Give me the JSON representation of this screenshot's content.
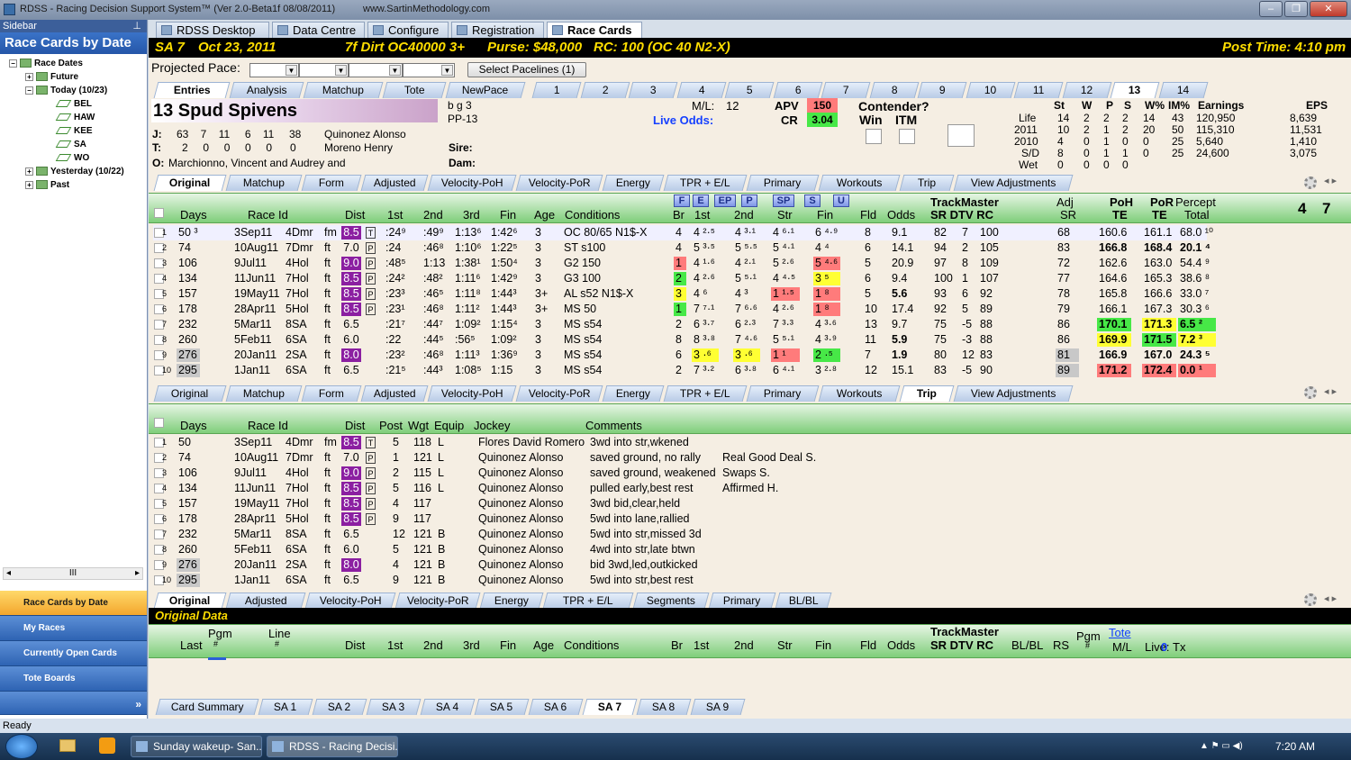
{
  "window": {
    "title": "RDSS - Racing Decision Support System™ (Ver 2.0-Beta1f  08/08/2011)",
    "site": "www.SartinMethodology.com"
  },
  "sidebar": {
    "header": "Sidebar",
    "title": "Race Cards by Date",
    "tree": [
      "Race Dates",
      "Future",
      "Today (10/23)",
      "BEL",
      "HAW",
      "KEE",
      "SA",
      "WO",
      "Yesterday (10/22)",
      "Past"
    ],
    "scroll": "III",
    "buttons": [
      "Race Cards by Date",
      "My Races",
      "Currently Open Cards",
      "Tote Boards"
    ],
    "more": "»"
  },
  "toptabs": [
    "RDSS Desktop",
    "Data Centre",
    "Configure",
    "Registration",
    "Race Cards"
  ],
  "race": {
    "track": "SA  7",
    "date": "Oct 23, 2011",
    "type": "7f  Dirt   OC40000  3+",
    "purse": "Purse: $48,000",
    "rc": "RC: 100  (OC 40 N2-X)",
    "post": "Post Time: 4:10 pm"
  },
  "pace": {
    "label": "Projected Pace:",
    "button": "Select Pacelines  (1)"
  },
  "entrytabs": [
    "Entries",
    "Analysis",
    "Matchup",
    "Tote",
    "NewPace"
  ],
  "horsetabs": [
    "1",
    "2",
    "3",
    "4",
    "5",
    "6",
    "7",
    "8",
    "9",
    "10",
    "11",
    "12",
    "13",
    "14"
  ],
  "horse": {
    "name": "13  Spud Spivens",
    "desc": "b g 3",
    "pp": "PP-13",
    "ml_label": "M/L:",
    "ml": "12",
    "live_odds": "Live Odds:",
    "apv_label": "APV",
    "apv": "150",
    "cr_label": "CR",
    "cr": "3.04",
    "contender": "Contender?",
    "win": "Win",
    "itm": "ITM",
    "j_label": "J:",
    "j_stats": "63    7    11     6    11     38",
    "jockey": "Quinonez Alonso",
    "t_label": "T:",
    "t_stats": "2     0     0     0     0      0",
    "trainer": "Moreno Henry",
    "o_label": "O:",
    "owner": "Marchionno, Vincent and Audrey and",
    "sire": "Sire:",
    "dam": "Dam:"
  },
  "record": {
    "headers": [
      "St",
      "W",
      "P",
      "S",
      "W%",
      "IM%",
      "Earnings",
      "EPS"
    ],
    "rows": [
      {
        "label": "Life",
        "vals": [
          "14",
          "2",
          "2",
          "2",
          "14",
          "43",
          "120,950",
          "8,639"
        ]
      },
      {
        "label": "2011",
        "vals": [
          "10",
          "2",
          "1",
          "2",
          "20",
          "50",
          "115,310",
          "11,531"
        ]
      },
      {
        "label": "2010",
        "vals": [
          "4",
          "0",
          "1",
          "0",
          "0",
          "25",
          "5,640",
          "1,410"
        ]
      },
      {
        "label": "S/D",
        "vals": [
          "8",
          "0",
          "1",
          "1",
          "0",
          "25",
          "24,600",
          "3,075"
        ]
      },
      {
        "label": "Wet",
        "vals": [
          "0",
          "0",
          "0",
          "0",
          "",
          "",
          "",
          ""
        ]
      }
    ]
  },
  "tabs1": [
    "Original",
    "Matchup",
    "Form",
    "Adjusted",
    "Velocity-PoH",
    "Velocity-PoR",
    "Energy",
    "TPR + E/L",
    "Primary",
    "Workouts",
    "Trip",
    "View Adjustments"
  ],
  "tabs2": [
    "Original",
    "Matchup",
    "Form",
    "Adjusted",
    "Velocity-PoH",
    "Velocity-PoR",
    "Energy",
    "TPR + E/L",
    "Primary",
    "Workouts",
    "Trip",
    "View Adjustments"
  ],
  "tabs3": [
    "Original",
    "Adjusted",
    "Velocity-PoH",
    "Velocity-PoR",
    "Energy",
    "TPR + E/L",
    "Segments",
    "Primary",
    "BL/BL"
  ],
  "filters": [
    "F",
    "E",
    "EP",
    "P",
    "SP",
    "S",
    "U"
  ],
  "grid1": {
    "h": [
      "Days",
      "Race Id",
      "Dist",
      "1st",
      "2nd",
      "3rd",
      "Fin",
      "Age",
      "Conditions",
      "Br",
      "1st",
      "2nd",
      "Str",
      "Fin",
      "Fld",
      "Odds",
      "TrackMaster",
      "SR DTV RC",
      "Adj",
      "SR",
      "PoH",
      "TE",
      "PoR",
      "TE",
      "Percept",
      "Total",
      "4",
      "7"
    ],
    "rows": [
      [
        "1",
        "50 ³",
        "3Sep11",
        "4Dmr",
        "fm",
        "8.5",
        "T",
        ":24⁹",
        ":49⁹",
        "1:13⁶",
        "1:42⁶",
        "3",
        "OC 80/65 N1$-X",
        "4",
        "4 ²·⁵",
        "4 ³·¹",
        "4 ⁶·¹",
        "6 ⁴·⁹",
        "8",
        "9.1",
        "82",
        "7",
        "100",
        "68",
        "160.6",
        "161.1",
        "68.0 ¹⁰"
      ],
      [
        "2",
        "74",
        "10Aug11",
        "7Dmr",
        "ft",
        "7.0",
        "P",
        ":24",
        ":46⁸",
        "1:10⁶",
        "1:22⁵",
        "3",
        "ST s100",
        "4",
        "5 ³·⁵",
        "5 ⁵·⁵",
        "5 ⁴·¹",
        "4 ⁴",
        "6",
        "14.1",
        "94",
        "2",
        "105",
        "83",
        "166.8",
        "168.4",
        "20.1 ⁴"
      ],
      [
        "3",
        "106",
        "9Jul11",
        "4Hol",
        "ft",
        "9.0",
        "P",
        ":48⁵",
        "1:13",
        "1:38¹",
        "1:50⁴",
        "3",
        "G2 150",
        "1",
        "4 ¹·⁶",
        "4 ²·¹",
        "5 ²·⁶",
        "5 ⁴·⁶",
        "5",
        "20.9",
        "97",
        "8",
        "109",
        "72",
        "162.6",
        "163.0",
        "54.4 ⁹"
      ],
      [
        "4",
        "134",
        "11Jun11",
        "7Hol",
        "ft",
        "8.5",
        "P",
        ":24²",
        ":48²",
        "1:11⁶",
        "1:42⁹",
        "3",
        "G3 100",
        "2",
        "4 ²·⁶",
        "5 ⁵·¹",
        "4 ⁴·⁵",
        "3 ⁵",
        "6",
        "9.4",
        "100",
        "1",
        "107",
        "77",
        "164.6",
        "165.3",
        "38.6 ⁸"
      ],
      [
        "5",
        "157",
        "19May11",
        "7Hol",
        "ft",
        "8.5",
        "P",
        ":23³",
        ":46⁵",
        "1:11⁸",
        "1:44³",
        "3+",
        "AL s52 N1$-X",
        "3",
        "4 ⁶",
        "4 ³",
        "1 ¹·⁵",
        "1 ⁸",
        "5",
        "5.6",
        "93",
        "6",
        "92",
        "78",
        "165.8",
        "166.6",
        "33.0 ⁷"
      ],
      [
        "6",
        "178",
        "28Apr11",
        "5Hol",
        "ft",
        "8.5",
        "P",
        ":23¹",
        ":46⁸",
        "1:11²",
        "1:44³",
        "3+",
        "MS 50",
        "1",
        "7 ⁷·¹",
        "7 ⁶·⁶",
        "4 ²·⁶",
        "1 ⁸",
        "10",
        "17.4",
        "92",
        "5",
        "89",
        "79",
        "166.1",
        "167.3",
        "30.3 ⁶"
      ],
      [
        "7",
        "232",
        "5Mar11",
        "8SA",
        "ft",
        "6.5",
        "",
        ":21⁷",
        ":44⁷",
        "1:09²",
        "1:15⁴",
        "3",
        "MS s54",
        "2",
        "6 ³·⁷",
        "6 ²·³",
        "7 ³·³",
        "4 ³·⁶",
        "13",
        "9.7",
        "75",
        "-5",
        "88",
        "86",
        "170.1",
        "171.3",
        "6.5 ²"
      ],
      [
        "8",
        "260",
        "5Feb11",
        "6SA",
        "ft",
        "6.0",
        "",
        ":22",
        ":44⁵",
        ":56⁵",
        "1:09²",
        "3",
        "MS s54",
        "8",
        "8 ³·⁸",
        "7 ⁴·⁶",
        "5 ⁵·¹",
        "4 ³·⁹",
        "11",
        "5.9",
        "75",
        "-3",
        "88",
        "86",
        "169.9",
        "171.5",
        "7.2 ³"
      ],
      [
        "9",
        "276",
        "20Jan11",
        "2SA",
        "ft",
        "8.0",
        "",
        ":23²",
        ":46⁸",
        "1:11³",
        "1:36⁹",
        "3",
        "MS s54",
        "6",
        "3 ·⁶",
        "3 ·⁶",
        "1 ¹",
        "2 ·⁵",
        "7",
        "1.9",
        "80",
        "12",
        "83",
        "81",
        "166.9",
        "167.0",
        "24.3 ⁵"
      ],
      [
        "10",
        "295",
        "1Jan11",
        "6SA",
        "ft",
        "6.5",
        "",
        ":21⁵",
        ":44³",
        "1:08⁵",
        "1:15",
        "3",
        "MS s54",
        "2",
        "7 ³·²",
        "6 ³·⁸",
        "6 ⁴·¹",
        "3 ²·⁸",
        "12",
        "15.1",
        "83",
        "-5",
        "90",
        "89",
        "171.2",
        "172.4",
        "0.0 ¹"
      ]
    ]
  },
  "grid2": {
    "h": [
      "Days",
      "Race Id",
      "Dist",
      "Post",
      "Wgt",
      "Equip",
      "Jockey",
      "Comments"
    ],
    "rows": [
      [
        "1",
        "50",
        "3Sep11",
        "4Dmr",
        "fm",
        "8.5",
        "T",
        "5",
        "118",
        "L",
        "Flores David Romero",
        "3wd into str,wkened",
        ""
      ],
      [
        "2",
        "74",
        "10Aug11",
        "7Dmr",
        "ft",
        "7.0",
        "P",
        "1",
        "121",
        "L",
        "Quinonez Alonso",
        "saved ground, no rally",
        "Real Good Deal S."
      ],
      [
        "3",
        "106",
        "9Jul11",
        "4Hol",
        "ft",
        "9.0",
        "P",
        "2",
        "115",
        "L",
        "Quinonez Alonso",
        "saved ground, weakened",
        "Swaps S."
      ],
      [
        "4",
        "134",
        "11Jun11",
        "7Hol",
        "ft",
        "8.5",
        "P",
        "5",
        "116",
        "L",
        "Quinonez Alonso",
        "pulled early,best rest",
        "Affirmed H."
      ],
      [
        "5",
        "157",
        "19May11",
        "7Hol",
        "ft",
        "8.5",
        "P",
        "4",
        "117",
        "",
        "Quinonez Alonso",
        "3wd bid,clear,held",
        ""
      ],
      [
        "6",
        "178",
        "28Apr11",
        "5Hol",
        "ft",
        "8.5",
        "P",
        "9",
        "117",
        "",
        "Quinonez Alonso",
        "5wd into lane,rallied",
        ""
      ],
      [
        "7",
        "232",
        "5Mar11",
        "8SA",
        "ft",
        "6.5",
        "",
        "12",
        "121",
        "B",
        "Quinonez Alonso",
        "5wd into str,missed 3d",
        ""
      ],
      [
        "8",
        "260",
        "5Feb11",
        "6SA",
        "ft",
        "6.0",
        "",
        "5",
        "121",
        "B",
        "Quinonez Alonso",
        "4wd into str,late btwn",
        ""
      ],
      [
        "9",
        "276",
        "20Jan11",
        "2SA",
        "ft",
        "8.0",
        "",
        "4",
        "121",
        "B",
        "Quinonez Alonso",
        "bid 3wd,led,outkicked",
        ""
      ],
      [
        "10",
        "295",
        "1Jan11",
        "6SA",
        "ft",
        "6.5",
        "",
        "9",
        "121",
        "B",
        "Quinonez Alonso",
        "5wd into str,best rest",
        ""
      ]
    ]
  },
  "original_data": {
    "title": "Original Data",
    "h": [
      "Last",
      "Pgm",
      "#",
      "Line",
      "#",
      "Dist",
      "1st",
      "2nd",
      "3rd",
      "Fin",
      "Age",
      "Conditions",
      "Br",
      "1st",
      "2nd",
      "Str",
      "Fin",
      "Fld",
      "Odds",
      "TrackMaster",
      "SR DTV RC",
      "BL/BL",
      "RS",
      "Pgm",
      "#",
      "Tote",
      "M/L",
      "Live:",
      "0",
      "Tx"
    ]
  },
  "bottomtabs": [
    "Card Summary",
    "SA 1",
    "SA 2",
    "SA 3",
    "SA 4",
    "SA 5",
    "SA 6",
    "SA 7",
    "SA 8",
    "SA 9"
  ],
  "status": "Ready",
  "taskbar": {
    "items": [
      "Sunday wakeup- San...",
      "RDSS - Racing Decisi..."
    ],
    "time": "7:20 AM"
  },
  "colors": {
    "purple": "#8b1fa1",
    "yellow": "#ffff33",
    "red": "#ff7b7b",
    "green": "#47e847",
    "gridheader": "#7fce7a"
  }
}
